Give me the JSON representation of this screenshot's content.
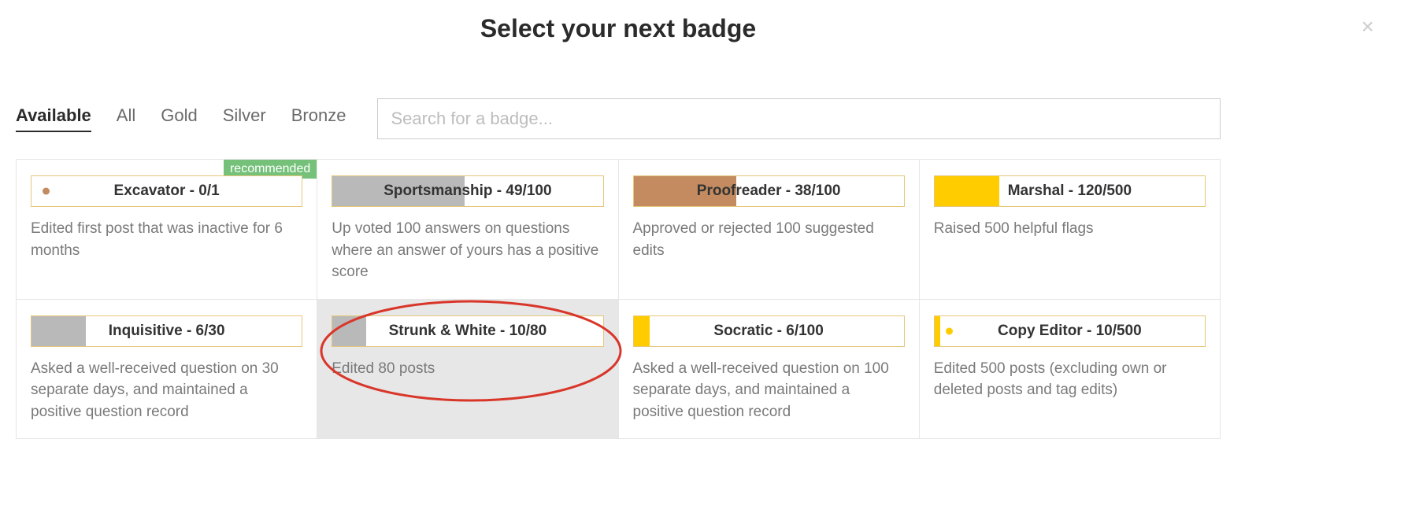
{
  "dialog": {
    "title": "Select your next badge",
    "close_glyph": "×",
    "recommended_label": "recommended"
  },
  "search": {
    "placeholder": "Search for a badge..."
  },
  "tabs": {
    "available": "Available",
    "all": "All",
    "gold": "Gold",
    "silver": "Silver",
    "bronze": "Bronze"
  },
  "badges": [
    {
      "name": "Excavator",
      "progress": "0/1",
      "fill_pct": 0,
      "tier": "bronze",
      "dot": "bronze",
      "recommended": true,
      "highlight": false,
      "desc": "Edited first post that was inactive for 6 months"
    },
    {
      "name": "Sportsmanship",
      "progress": "49/100",
      "fill_pct": 49,
      "tier": "silver",
      "dot": null,
      "recommended": false,
      "highlight": false,
      "desc": "Up voted 100 answers on questions where an answer of yours has a positive score"
    },
    {
      "name": "Proofreader",
      "progress": "38/100",
      "fill_pct": 38,
      "tier": "bronze",
      "dot": null,
      "recommended": false,
      "highlight": false,
      "desc": "Approved or rejected 100 suggested edits"
    },
    {
      "name": "Marshal",
      "progress": "120/500",
      "fill_pct": 24,
      "tier": "gold",
      "dot": null,
      "recommended": false,
      "highlight": false,
      "desc": "Raised 500 helpful flags"
    },
    {
      "name": "Inquisitive",
      "progress": "6/30",
      "fill_pct": 20,
      "tier": "silver",
      "dot": null,
      "recommended": false,
      "highlight": false,
      "desc": "Asked a well-received question on 30 separate days, and maintained a positive question record"
    },
    {
      "name": "Strunk & White",
      "progress": "10/80",
      "fill_pct": 12.5,
      "tier": "silver",
      "dot": null,
      "recommended": false,
      "highlight": true,
      "desc": "Edited 80 posts"
    },
    {
      "name": "Socratic",
      "progress": "6/100",
      "fill_pct": 6,
      "tier": "gold",
      "dot": null,
      "recommended": false,
      "highlight": false,
      "desc": "Asked a well-received question on 100 separate days, and maintained a positive question record"
    },
    {
      "name": "Copy Editor",
      "progress": "10/500",
      "fill_pct": 2,
      "tier": "gold",
      "dot": "gold",
      "recommended": false,
      "highlight": false,
      "desc": "Edited 500 posts (excluding own or deleted posts and tag edits)"
    }
  ],
  "annotation": {
    "circle_color": "#d9362a"
  }
}
